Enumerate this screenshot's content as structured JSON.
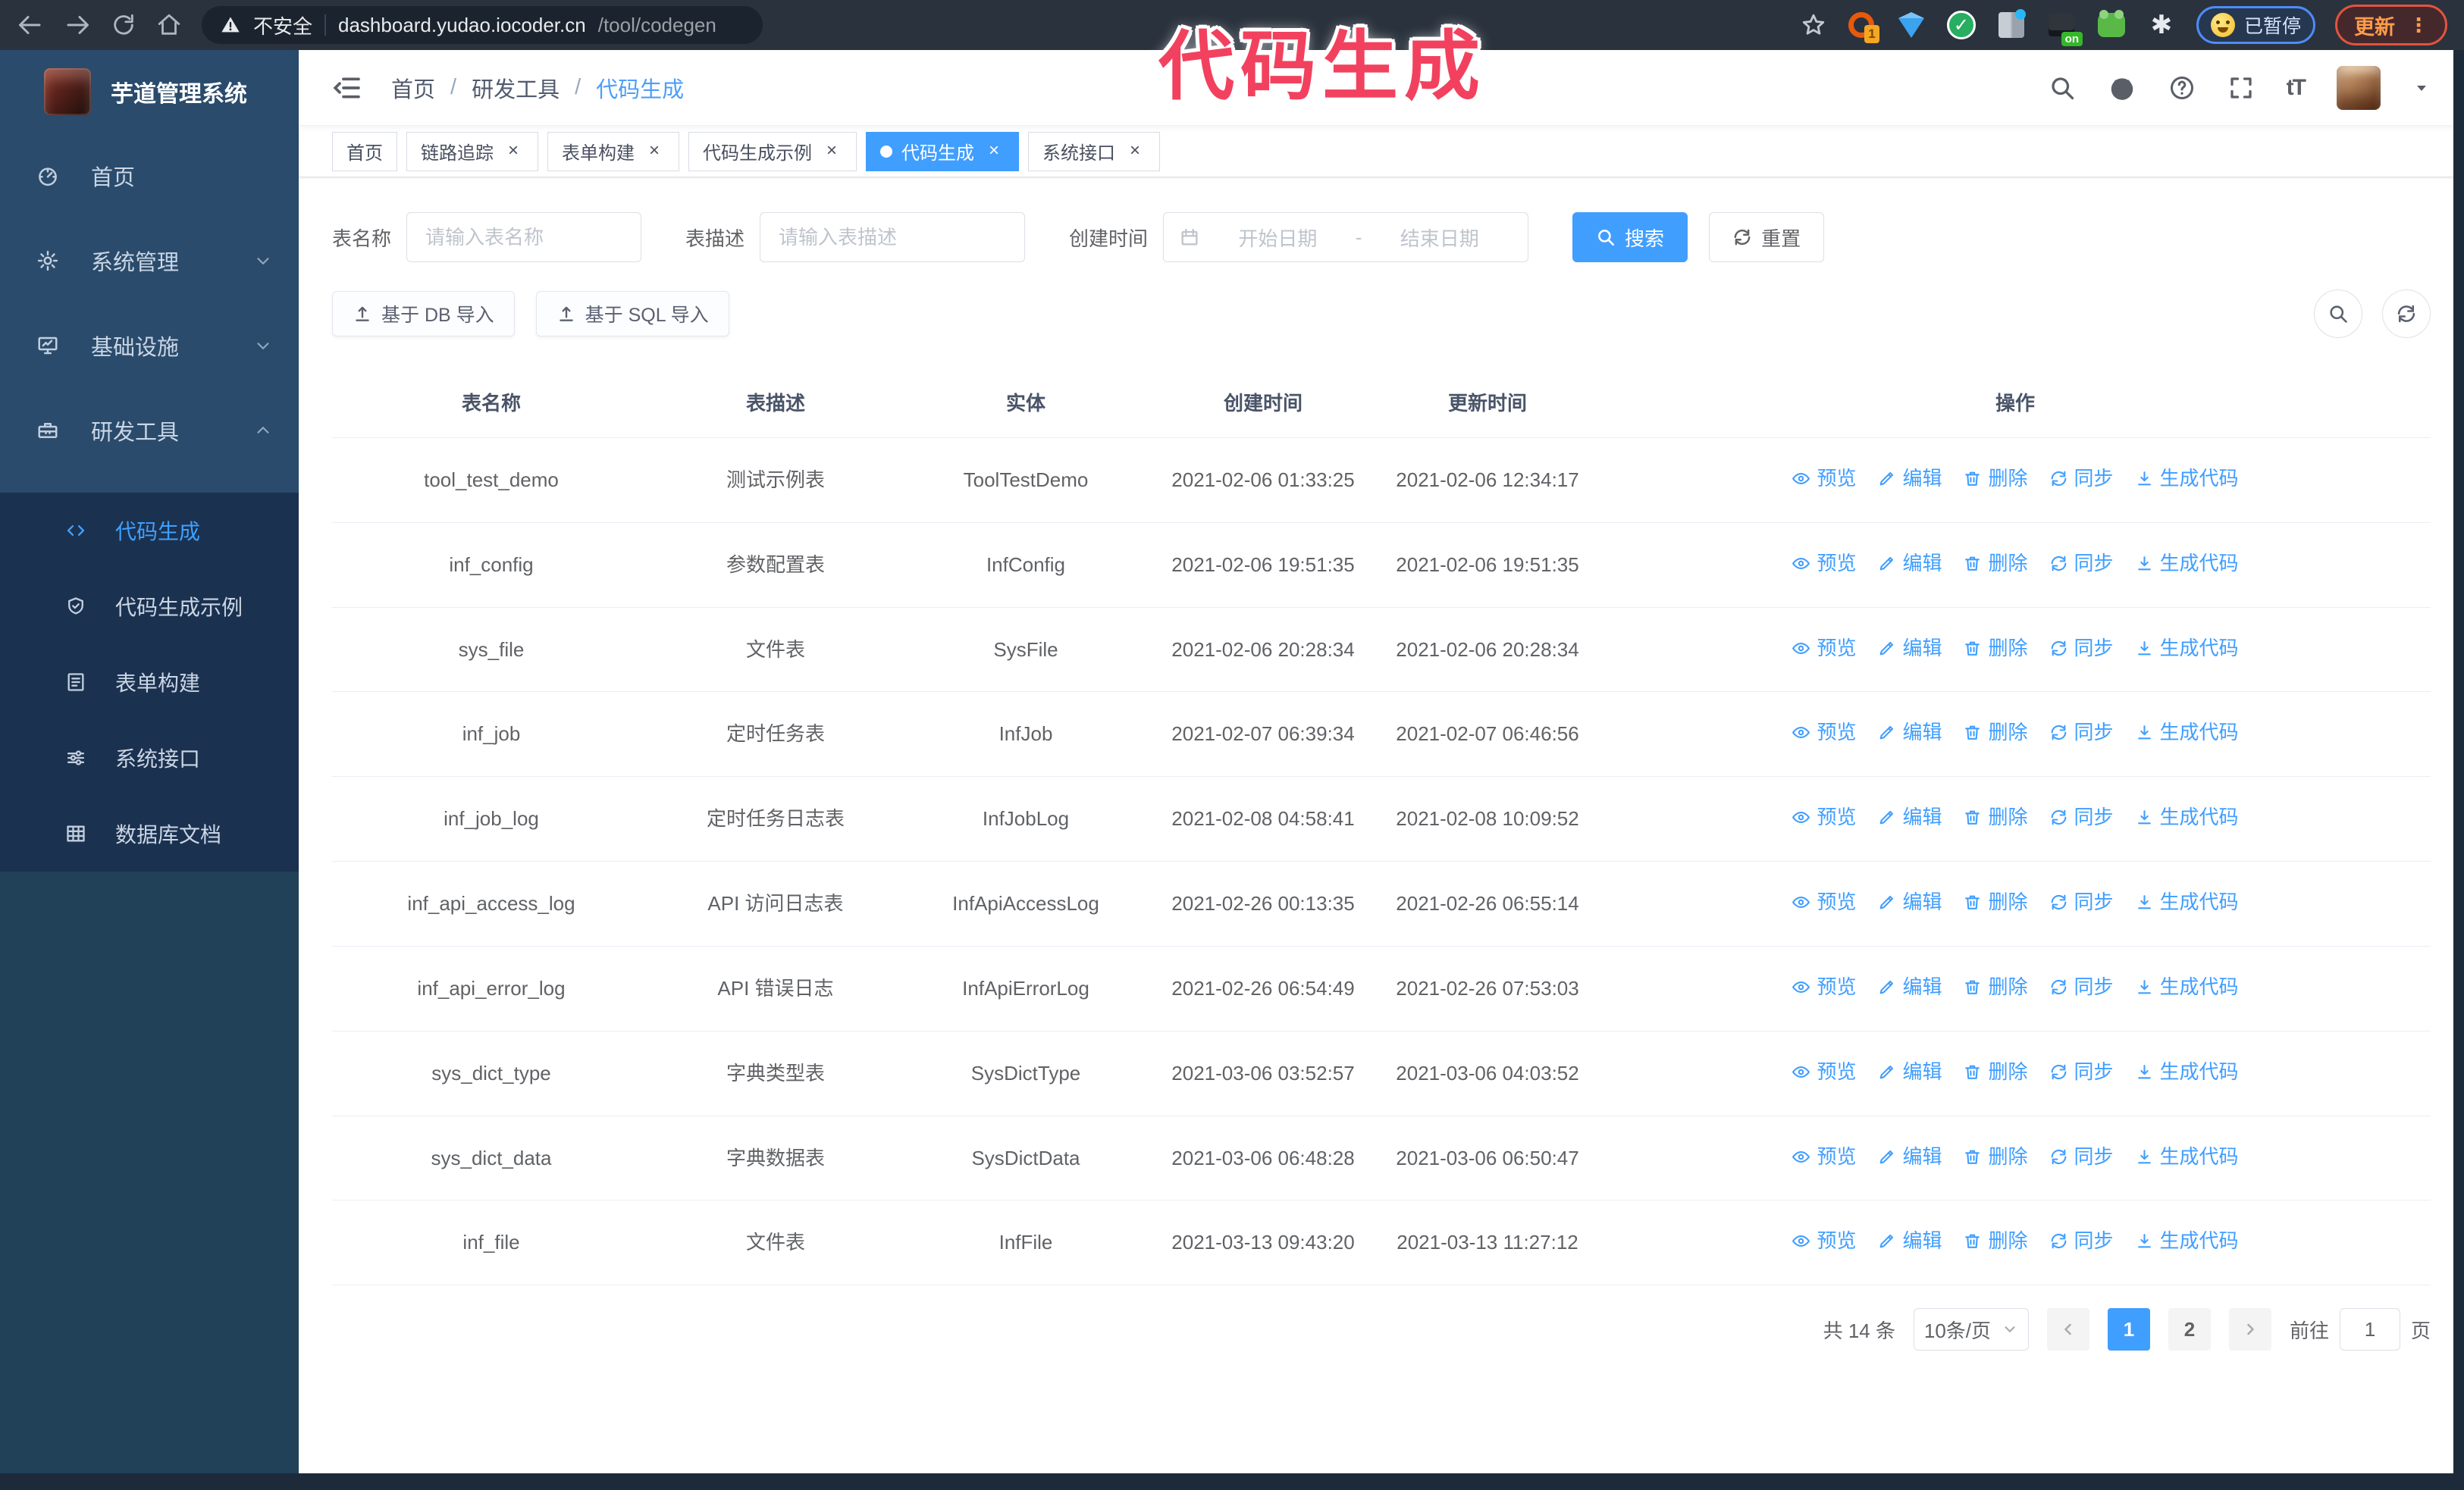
{
  "browser": {
    "security_label": "不安全",
    "url_host": "dashboard.yudao.iocoder.cn",
    "url_path": "/tool/codegen",
    "paused_badge": "已暂停",
    "update_label": "更新"
  },
  "overlay_title": "代码生成",
  "sidebar": {
    "app_title": "芋道管理系统",
    "top_items": [
      {
        "label": "首页",
        "icon": "dashboard-icon",
        "arrow": null,
        "active": false
      },
      {
        "label": "系统管理",
        "icon": "gear-icon",
        "arrow": "down",
        "active": false
      },
      {
        "label": "基础设施",
        "icon": "monitor-icon",
        "arrow": "down",
        "active": false
      },
      {
        "label": "研发工具",
        "icon": "toolbox-icon",
        "arrow": "up",
        "active": false
      }
    ],
    "sub_items": [
      {
        "label": "代码生成",
        "icon": "code-icon",
        "active": true
      },
      {
        "label": "代码生成示例",
        "icon": "shield-check-icon",
        "active": false
      },
      {
        "label": "表单构建",
        "icon": "form-icon",
        "active": false
      },
      {
        "label": "系统接口",
        "icon": "sliders-icon",
        "active": false
      },
      {
        "label": "数据库文档",
        "icon": "table-grid-icon",
        "active": false
      }
    ]
  },
  "header": {
    "breadcrumb": [
      "首页",
      "研发工具",
      "代码生成"
    ],
    "right_icons": [
      "search-icon",
      "github-icon",
      "help-icon",
      "fullscreen-icon",
      "font-size-icon",
      "avatar",
      "caret-down-icon"
    ],
    "font_size_glyph": "tT"
  },
  "tags": [
    {
      "label": "首页",
      "closable": false,
      "active": false
    },
    {
      "label": "链路追踪",
      "closable": true,
      "active": false
    },
    {
      "label": "表单构建",
      "closable": true,
      "active": false
    },
    {
      "label": "代码生成示例",
      "closable": true,
      "active": false
    },
    {
      "label": "代码生成",
      "closable": true,
      "active": true
    },
    {
      "label": "系统接口",
      "closable": true,
      "active": false
    }
  ],
  "search_form": {
    "name_label": "表名称",
    "name_placeholder": "请输入表名称",
    "desc_label": "表描述",
    "desc_placeholder": "请输入表描述",
    "time_label": "创建时间",
    "start_placeholder": "开始日期",
    "range_separator": "-",
    "end_placeholder": "结束日期",
    "search_label": "搜索",
    "reset_label": "重置"
  },
  "toolbar": {
    "import_db_label": "基于 DB 导入",
    "import_sql_label": "基于 SQL 导入"
  },
  "table": {
    "columns": [
      "表名称",
      "表描述",
      "实体",
      "创建时间",
      "更新时间",
      "操作"
    ],
    "actions": [
      {
        "label": "预览",
        "icon": "eye-icon",
        "name": "preview-action"
      },
      {
        "label": "编辑",
        "icon": "edit-icon",
        "name": "edit-action"
      },
      {
        "label": "删除",
        "icon": "delete-icon",
        "name": "delete-action"
      },
      {
        "label": "同步",
        "icon": "sync-icon",
        "name": "sync-action"
      },
      {
        "label": "生成代码",
        "icon": "download-icon",
        "name": "generate-code-action"
      }
    ],
    "rows": [
      {
        "name": "tool_test_demo",
        "desc": "测试示例表",
        "entity": "ToolTestDemo",
        "created": "2021-02-06 01:33:25",
        "updated": "2021-02-06 12:34:17"
      },
      {
        "name": "inf_config",
        "desc": "参数配置表",
        "entity": "InfConfig",
        "created": "2021-02-06 19:51:35",
        "updated": "2021-02-06 19:51:35"
      },
      {
        "name": "sys_file",
        "desc": "文件表",
        "entity": "SysFile",
        "created": "2021-02-06 20:28:34",
        "updated": "2021-02-06 20:28:34"
      },
      {
        "name": "inf_job",
        "desc": "定时任务表",
        "entity": "InfJob",
        "created": "2021-02-07 06:39:34",
        "updated": "2021-02-07 06:46:56"
      },
      {
        "name": "inf_job_log",
        "desc": "定时任务日志表",
        "entity": "InfJobLog",
        "created": "2021-02-08 04:58:41",
        "updated": "2021-02-08 10:09:52"
      },
      {
        "name": "inf_api_access_log",
        "desc": "API 访问日志表",
        "entity": "InfApiAccessLog",
        "created": "2021-02-26 00:13:35",
        "updated": "2021-02-26 06:55:14"
      },
      {
        "name": "inf_api_error_log",
        "desc": "API 错误日志",
        "entity": "InfApiErrorLog",
        "created": "2021-02-26 06:54:49",
        "updated": "2021-02-26 07:53:03"
      },
      {
        "name": "sys_dict_type",
        "desc": "字典类型表",
        "entity": "SysDictType",
        "created": "2021-03-06 03:52:57",
        "updated": "2021-03-06 04:03:52"
      },
      {
        "name": "sys_dict_data",
        "desc": "字典数据表",
        "entity": "SysDictData",
        "created": "2021-03-06 06:48:28",
        "updated": "2021-03-06 06:50:47"
      },
      {
        "name": "inf_file",
        "desc": "文件表",
        "entity": "InfFile",
        "created": "2021-03-13 09:43:20",
        "updated": "2021-03-13 11:27:12"
      }
    ]
  },
  "pagination": {
    "total_label": "共 14 条",
    "page_size_label": "10条/页",
    "pages": [
      "1",
      "2"
    ],
    "active_page": "1",
    "goto_label": "前往",
    "goto_value": "1",
    "goto_suffix": "页"
  },
  "colors": {
    "accent": "#409EFF",
    "overlay_pink": "#F2415E",
    "sidebar_bg": "#214159",
    "sidebar_top_bg": "#2A4B6C",
    "submenu_bg": "#1B3150",
    "browser_bar_bg": "#2A323D"
  }
}
